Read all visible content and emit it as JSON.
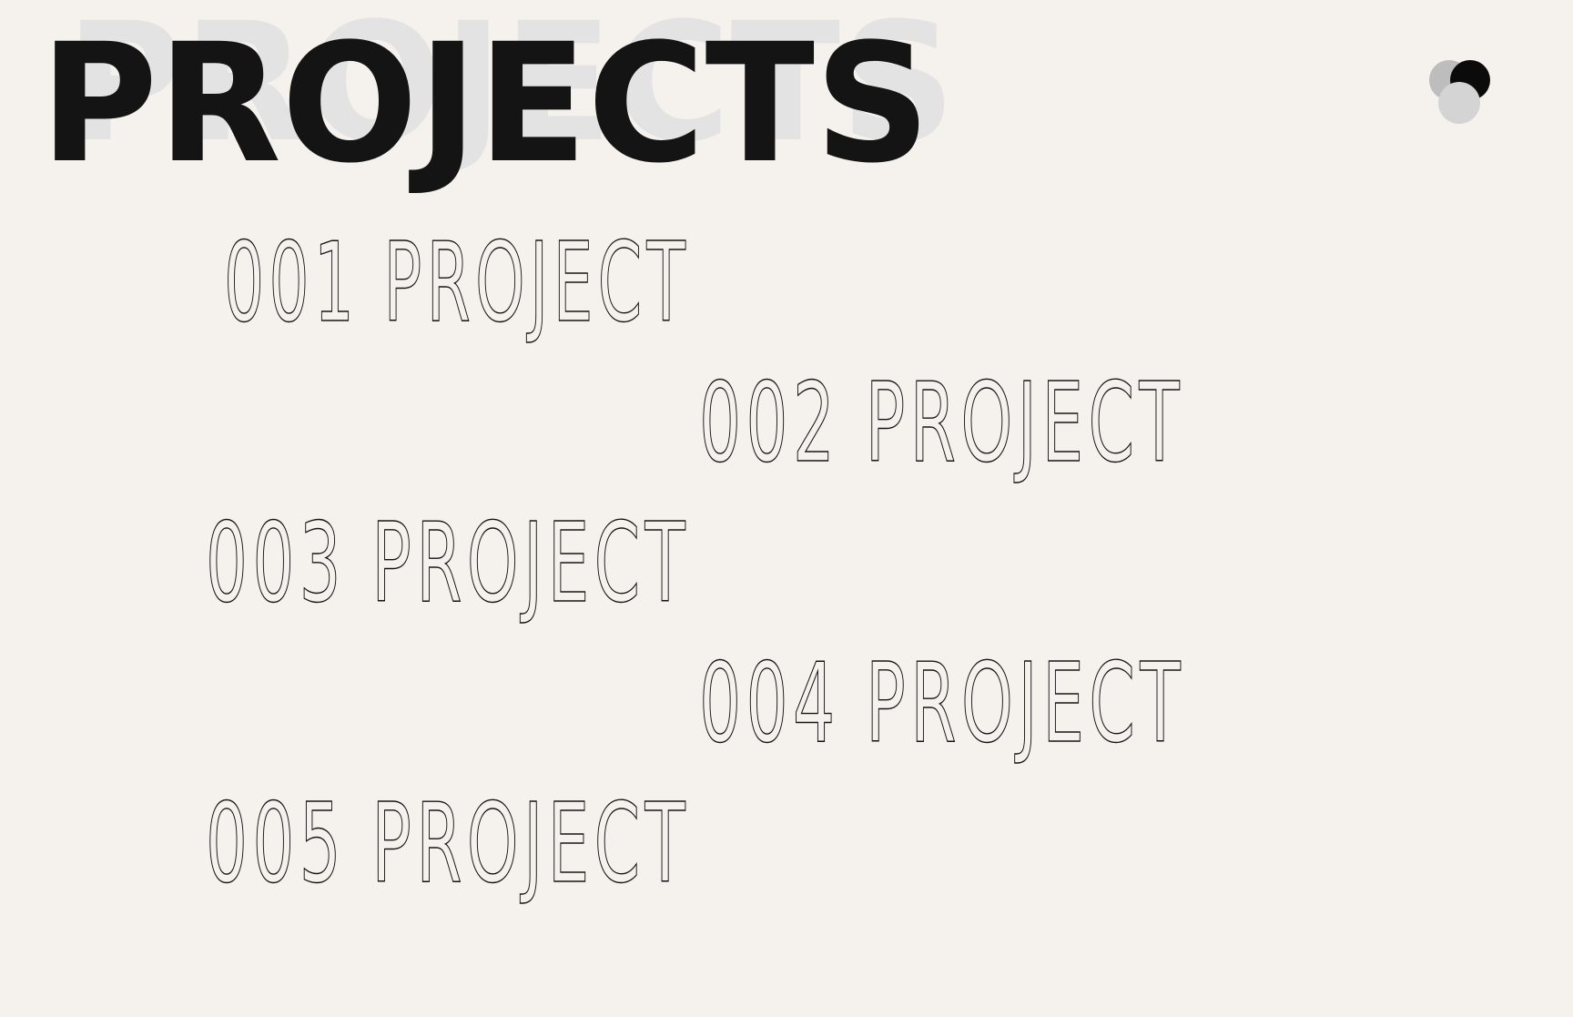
{
  "header": {
    "title": "PROJECTS",
    "title_shadow": "PROJECTS",
    "logo": {
      "icon": "three-dots-logo-icon",
      "colors": [
        "#bdbdbd",
        "#0b0b0b",
        "#d4d4d4"
      ]
    }
  },
  "projects": [
    {
      "number": "001",
      "label": "PROJECT",
      "text": "001 PROJECT"
    },
    {
      "number": "002",
      "label": "PROJECT",
      "text": "002 PROJECT"
    },
    {
      "number": "003",
      "label": "PROJECT",
      "text": "003 PROJECT"
    },
    {
      "number": "004",
      "label": "PROJECT",
      "text": "004 PROJECT"
    },
    {
      "number": "005",
      "label": "PROJECT",
      "text": "005 PROJECT"
    }
  ],
  "colors": {
    "background": "#f5f1ed",
    "title": "#141414",
    "title_shadow": "#e3e3e3",
    "outline": "#141414"
  }
}
